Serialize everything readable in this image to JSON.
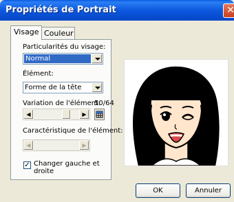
{
  "window": {
    "title": "Propriétés de Portrait",
    "close_glyph": "✕"
  },
  "tabs": [
    {
      "label": "Visage"
    },
    {
      "label": "Couleur"
    }
  ],
  "face_traits": {
    "label": "Particularités du visage:",
    "value": "Normal"
  },
  "element": {
    "label": "Élément:",
    "value": "Forme de la tête"
  },
  "variation": {
    "label": "Variation de l'élément:",
    "readout": "50/64",
    "position_fraction": 0.78
  },
  "characteristic": {
    "label": "Caractéristique de l'élément:"
  },
  "mirror": {
    "label_line1": "Changer gauche et",
    "label_line2": "droite",
    "checked": true,
    "check_glyph": "✓"
  },
  "buttons": {
    "ok": "OK",
    "cancel": "Annuler"
  },
  "colors": {
    "title_bar": "#0b55dd",
    "selection": "#316ac5",
    "skin": "#ffe6cc",
    "hair": "#000000",
    "mouth": "#d94a4a"
  }
}
